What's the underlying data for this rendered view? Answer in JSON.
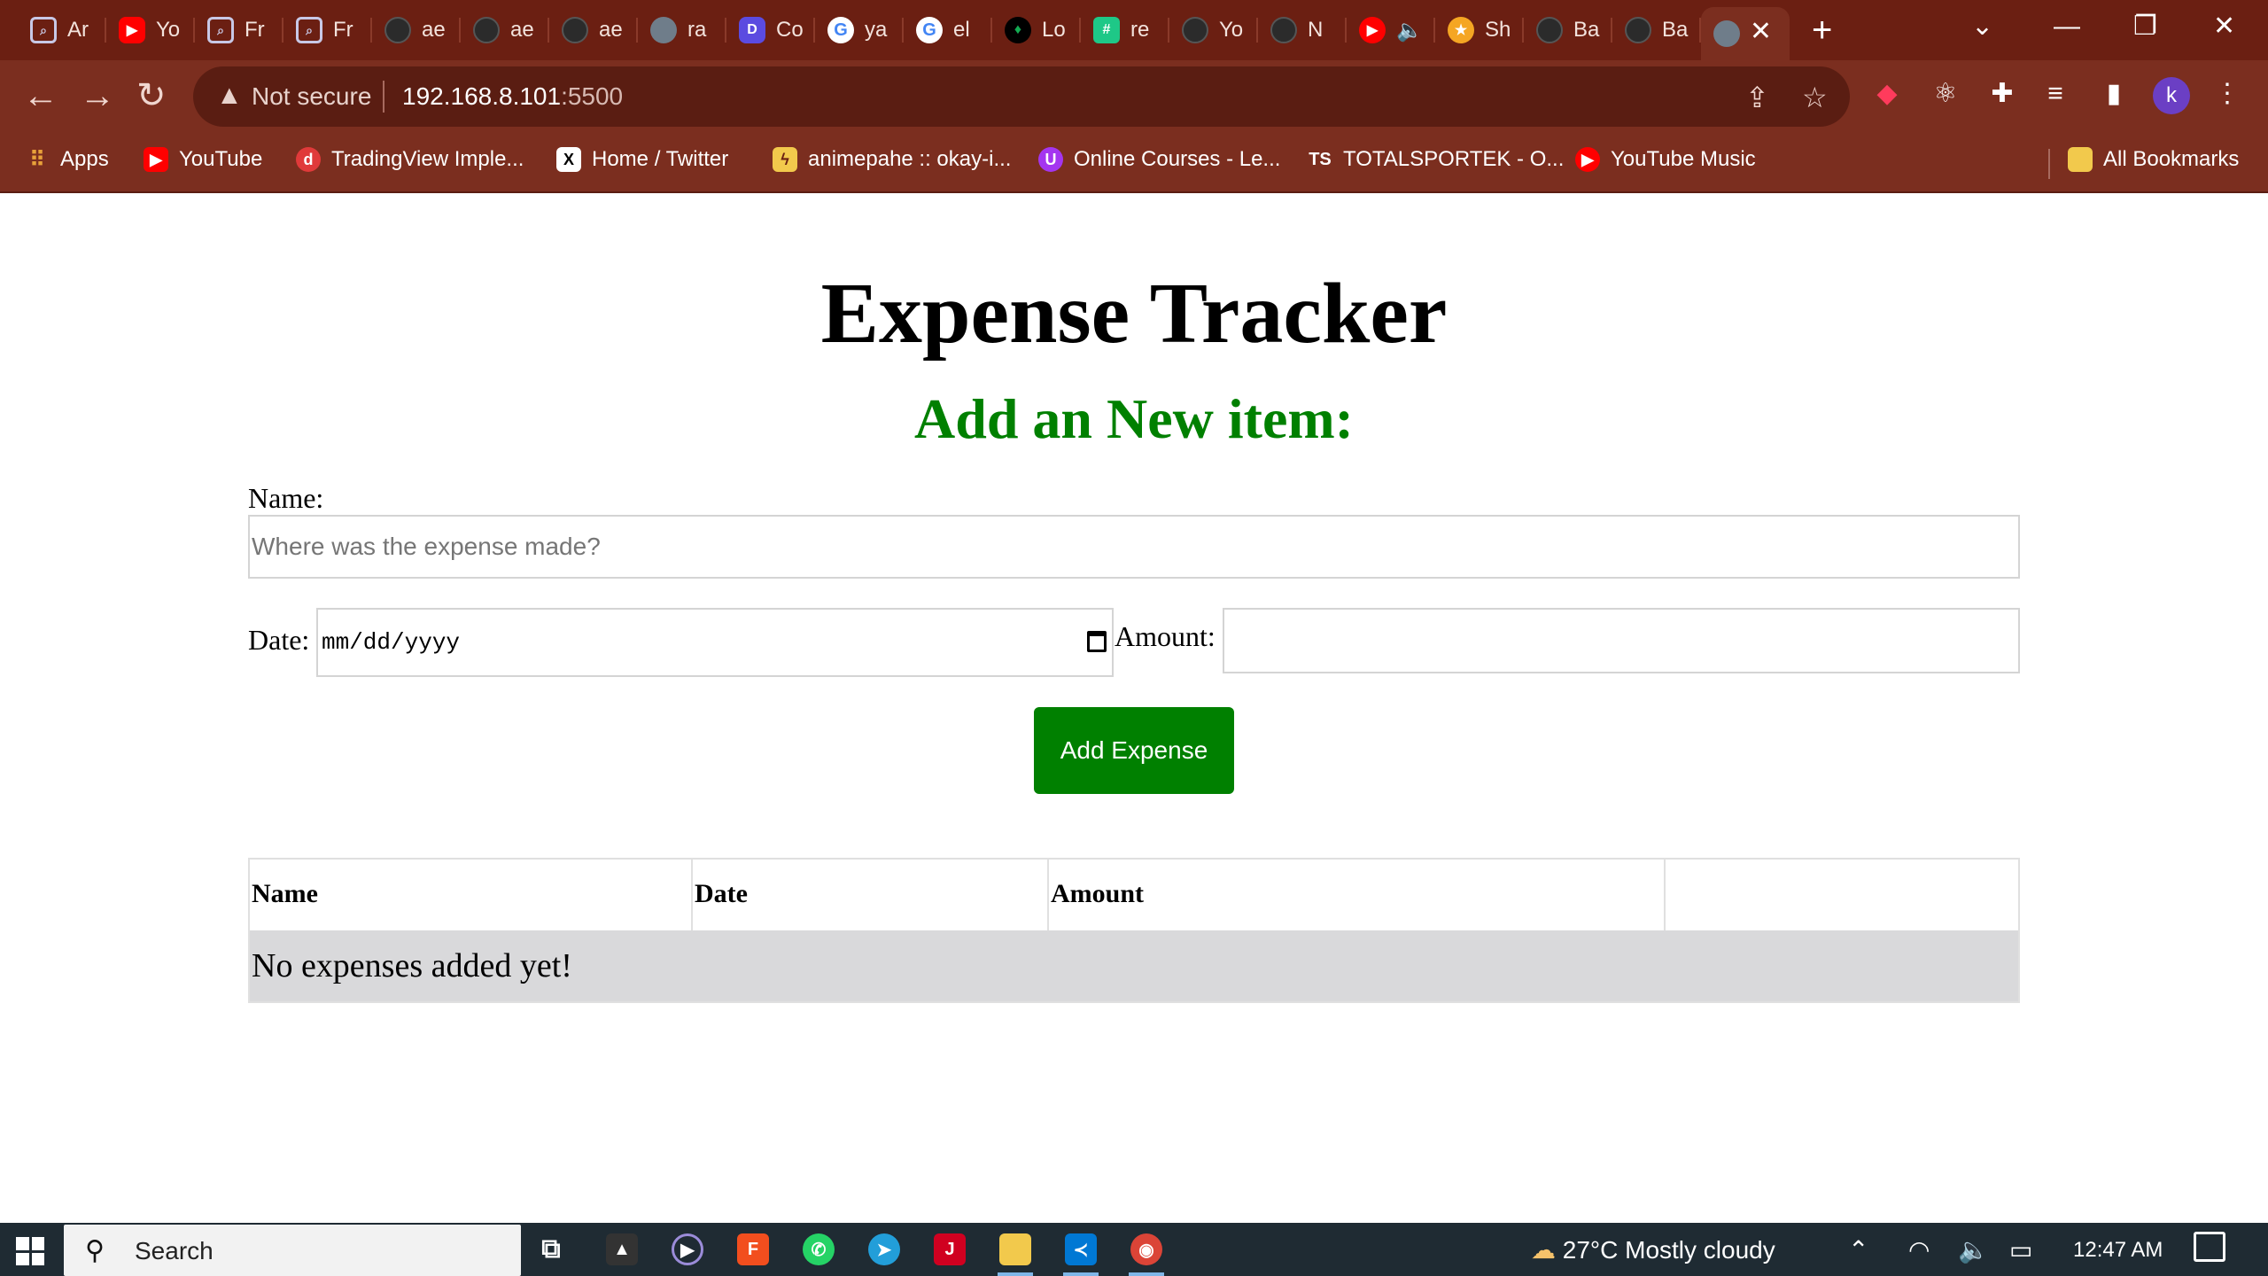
{
  "browser": {
    "tabs": [
      {
        "title": "Ar",
        "icon": "search-square-icon"
      },
      {
        "title": "Yo",
        "icon": "youtube-icon"
      },
      {
        "title": "Fr",
        "icon": "search-square-icon"
      },
      {
        "title": "Fr",
        "icon": "search-square-icon"
      },
      {
        "title": "ae",
        "icon": "github-icon"
      },
      {
        "title": "ae",
        "icon": "github-icon"
      },
      {
        "title": "ae",
        "icon": "github-icon"
      },
      {
        "title": "ra",
        "icon": "globe-icon"
      },
      {
        "title": "Co",
        "icon": "app-d-icon"
      },
      {
        "title": "ya",
        "icon": "google-icon"
      },
      {
        "title": "el",
        "icon": "google-icon"
      },
      {
        "title": "Lo",
        "icon": "leaf-icon"
      },
      {
        "title": "re",
        "icon": "grid-app-icon"
      },
      {
        "title": "Yo",
        "icon": "github-icon"
      },
      {
        "title": "N",
        "icon": "github-icon"
      },
      {
        "title": "",
        "icon": "youtube-music-icon"
      },
      {
        "title": "Sh",
        "icon": "star-icon"
      },
      {
        "title": "Ba",
        "icon": "github-icon"
      },
      {
        "title": "Ba",
        "icon": "github-icon"
      }
    ],
    "new_tab": "+",
    "omnibox": {
      "security": "Not secure",
      "host": "192.168.8.101",
      "port": ":5500"
    },
    "profile_initial": "k",
    "bookmarks": [
      {
        "label": "Apps",
        "icon": "apps-grid-icon"
      },
      {
        "label": "YouTube",
        "icon": "youtube-icon"
      },
      {
        "label": "TradingView Imple...",
        "icon": "d-logo-icon"
      },
      {
        "label": "Home / Twitter",
        "icon": "x-logo-icon"
      },
      {
        "label": "animepahe :: okay-i...",
        "icon": "pikachu-icon"
      },
      {
        "label": "Online Courses - Le...",
        "icon": "udemy-icon"
      },
      {
        "label": "TOTALSPORTEK - O...",
        "icon": "ts-logo-icon"
      },
      {
        "label": "YouTube Music",
        "icon": "youtube-music-icon"
      },
      {
        "label": "All Bookmarks",
        "icon": "folder-icon"
      }
    ]
  },
  "page": {
    "title": "Expense Tracker",
    "subtitle": "Add an New item:",
    "form": {
      "name_label": "Name:",
      "name_placeholder": "Where was the expense made?",
      "name_value": "",
      "date_label": "Date:",
      "date_placeholder": "mm/dd/yyyy",
      "amount_label": "Amount:",
      "amount_value": "",
      "submit_label": "Add Expense"
    },
    "table": {
      "headers": [
        "Name",
        "Date",
        "Amount",
        ""
      ],
      "empty_message": "No expenses added yet!"
    }
  },
  "taskbar": {
    "search_label": "Search",
    "weather": "27°C  Mostly cloudy",
    "time": "12:47 AM"
  },
  "colors": {
    "accent_green": "#008000",
    "browser_frame": "#7b2e1f",
    "table_empty_row": "#d9d9db"
  }
}
